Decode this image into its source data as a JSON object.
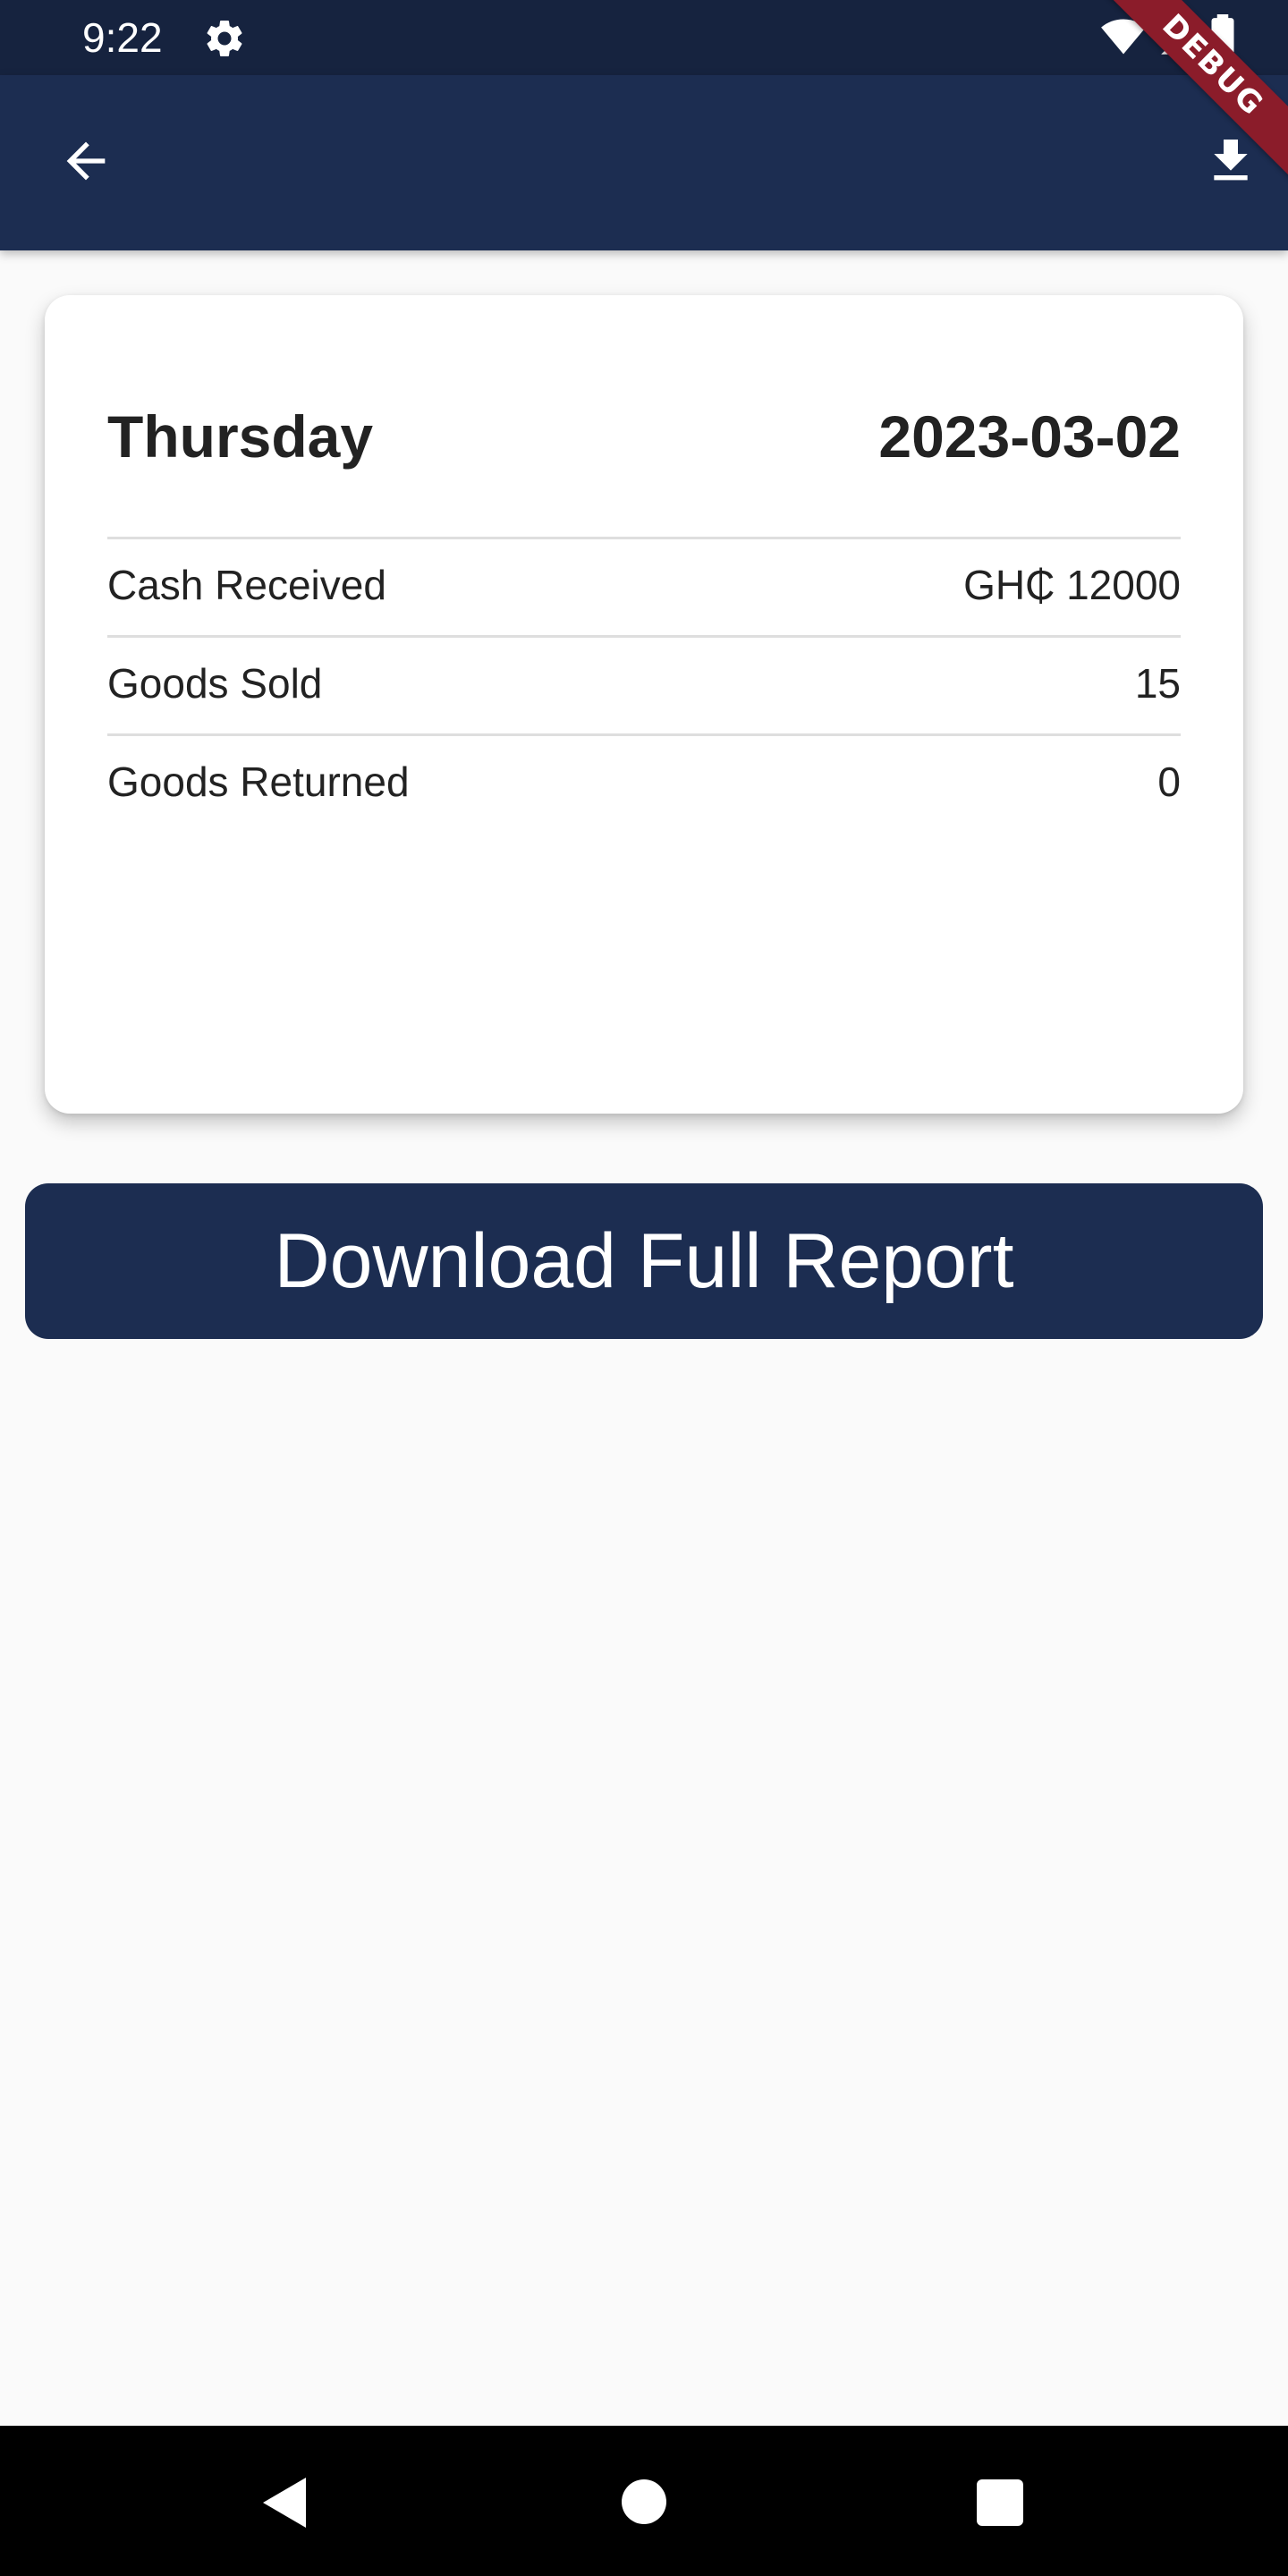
{
  "status_bar": {
    "time": "9:22",
    "icons": [
      "gear-icon",
      "wifi-icon",
      "signal-icon",
      "battery-icon"
    ]
  },
  "app_bar": {
    "back_icon": "arrow-left-icon",
    "action_icon": "download-icon",
    "background_color": "#1c2d51"
  },
  "debug_banner": {
    "text": "DEBUG"
  },
  "report_card": {
    "day": "Thursday",
    "date": "2023-03-02",
    "rows": [
      {
        "label": "Cash Received",
        "value": "GH₵ 12000"
      },
      {
        "label": "Goods Sold",
        "value": "15"
      },
      {
        "label": "Goods Returned",
        "value": "0"
      }
    ]
  },
  "download_button": {
    "label": "Download Full Report"
  },
  "nav_bar": {
    "icons": [
      "back-triangle-icon",
      "home-circle-icon",
      "recents-square-icon"
    ]
  }
}
